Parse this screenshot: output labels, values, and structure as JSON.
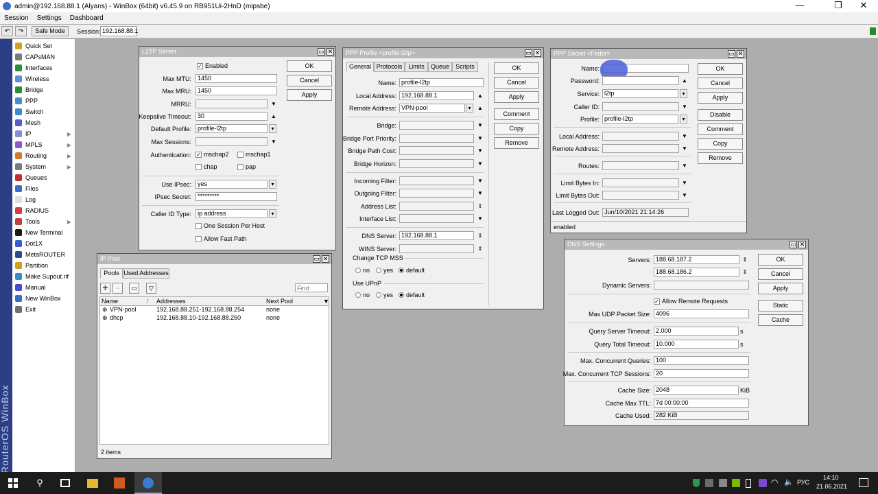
{
  "window": {
    "title": "admin@192.168.88.1 (Alyans) - WinBox (64bit) v6.45.9 on RB951Ui-2HnD (mipsbe)",
    "minimize": "—",
    "maximize": "❐",
    "close": "✕"
  },
  "menu": [
    "Session",
    "Settings",
    "Dashboard"
  ],
  "toolbar": {
    "undo": "↶",
    "redo": "↷",
    "safe_mode": "Safe Mode",
    "session_label": "Session:",
    "session_value": "192.168.88.1"
  },
  "brand": "RouterOS WinBox",
  "sidebar": [
    {
      "label": "Quick Set",
      "color": "#d4a020",
      "arrow": ""
    },
    {
      "label": "CAPsMAN",
      "color": "#7a7a7a",
      "arrow": ""
    },
    {
      "label": "Interfaces",
      "color": "#2e8b3a",
      "arrow": ""
    },
    {
      "label": "Wireless",
      "color": "#5b8fd0",
      "arrow": ""
    },
    {
      "label": "Bridge",
      "color": "#2e8b3a",
      "arrow": ""
    },
    {
      "label": "PPP",
      "color": "#4a8acb",
      "arrow": ""
    },
    {
      "label": "Switch",
      "color": "#3b8ad0",
      "arrow": ""
    },
    {
      "label": "Mesh",
      "color": "#5a5ad0",
      "arrow": ""
    },
    {
      "label": "IP",
      "color": "#8a8ad0",
      "arrow": "▶"
    },
    {
      "label": "MPLS",
      "color": "#8a5ad0",
      "arrow": "▶"
    },
    {
      "label": "Routing",
      "color": "#d07a2a",
      "arrow": "▶"
    },
    {
      "label": "System",
      "color": "#7a7a7a",
      "arrow": "▶"
    },
    {
      "label": "Queues",
      "color": "#c03030",
      "arrow": ""
    },
    {
      "label": "Files",
      "color": "#3a6fc4",
      "arrow": ""
    },
    {
      "label": "Log",
      "color": "#e0e0e0",
      "arrow": ""
    },
    {
      "label": "RADIUS",
      "color": "#d04040",
      "arrow": ""
    },
    {
      "label": "Tools",
      "color": "#c04040",
      "arrow": "▶"
    },
    {
      "label": "New Terminal",
      "color": "#1a1a1a",
      "arrow": ""
    },
    {
      "label": "Dot1X",
      "color": "#3a5ad0",
      "arrow": ""
    },
    {
      "label": "MetaROUTER",
      "color": "#2a4a9a",
      "arrow": ""
    },
    {
      "label": "Partition",
      "color": "#d0a020",
      "arrow": ""
    },
    {
      "label": "Make Supout.rif",
      "color": "#3a8ad0",
      "arrow": ""
    },
    {
      "label": "Manual",
      "color": "#4a4ad0",
      "arrow": ""
    },
    {
      "label": "New WinBox",
      "color": "#3a6fc4",
      "arrow": ""
    },
    {
      "label": "Exit",
      "color": "#707070",
      "arrow": ""
    }
  ],
  "l2tp": {
    "title": "L2TP Server",
    "enabled": "Enabled",
    "max_mtu_label": "Max MTU:",
    "max_mtu": "1450",
    "max_mru_label": "Max MRU:",
    "max_mru": "1450",
    "mrru_label": "MRRU:",
    "keepalive_label": "Keepalive Timeout:",
    "keepalive": "30",
    "default_profile_label": "Default Profile:",
    "default_profile": "profile-l2tp",
    "max_sessions_label": "Max Sessions:",
    "auth_label": "Authentication:",
    "auth_mschap2": "mschap2",
    "auth_mschap1": "mschap1",
    "auth_chap": "chap",
    "auth_pap": "pap",
    "use_ipsec_label": "Use IPsec:",
    "use_ipsec": "yes",
    "ipsec_secret_label": "IPsec Secret:",
    "ipsec_secret": "*********",
    "caller_id_label": "Caller ID Type:",
    "caller_id": "ip address",
    "one_session": "One Session Per Host",
    "allow_fast_path": "Allow Fast Path",
    "ok": "OK",
    "cancel": "Cancel",
    "apply": "Apply"
  },
  "ippool": {
    "title": "IP Pool",
    "tab_pools": "Pools",
    "tab_used": "Used Addresses",
    "add": "+",
    "remove": "−",
    "find_placeholder": "Find",
    "col_name": "Name",
    "col_addresses": "Addresses",
    "col_next": "Next Pool",
    "rows": [
      {
        "name": "VPN-pool",
        "addresses": "192.168.88.251-192.168.88.254",
        "next": "none"
      },
      {
        "name": "dhcp",
        "addresses": "192.168.88.10-192.168.88.250",
        "next": "none"
      }
    ],
    "status": "2 items"
  },
  "profile": {
    "title": "PPP Profile <profile-l2tp>",
    "tabs": [
      "General",
      "Protocols",
      "Limits",
      "Queue",
      "Scripts"
    ],
    "name_label": "Name:",
    "name": "profile-l2tp",
    "local_label": "Local Address:",
    "local": "192.168.88.1",
    "remote_label": "Remote Address:",
    "remote": "VPN-pool",
    "bridge_label": "Bridge:",
    "bpp_label": "Bridge Port Priority:",
    "bpc_label": "Bridge Path Cost:",
    "bh_label": "Bridge Horizon:",
    "in_filter_label": "Incoming Filter:",
    "out_filter_label": "Outgoing Filter:",
    "addr_list_label": "Address List:",
    "iface_list_label": "Interface List:",
    "dns_label": "DNS Server:",
    "dns": "192.168.88.1",
    "wins_label": "WINS Server:",
    "tcp_mss_label": "Change TCP MSS",
    "upnp_label": "Use UPnP",
    "opt_no": "no",
    "opt_yes": "yes",
    "opt_default": "default",
    "ok": "OK",
    "cancel": "Cancel",
    "apply": "Apply",
    "comment": "Comment",
    "copy": "Copy",
    "remove": "Remove"
  },
  "secret": {
    "title": "PPP Secret <Fedor>",
    "name_label": "Name:",
    "password_label": "Password:",
    "service_label": "Service:",
    "service": "l2tp",
    "caller_label": "Caller ID:",
    "profile_label": "Profile:",
    "profile": "profile-l2tp",
    "local_label": "Local Address:",
    "remote_label": "Remote Address:",
    "routes_label": "Routes:",
    "limit_in_label": "Limit Bytes In:",
    "limit_out_label": "Limit Bytes Out:",
    "last_logged_label": "Last Logged Out:",
    "last_logged": "Jun/10/2021 21:14:26",
    "status": "enabled",
    "ok": "OK",
    "cancel": "Cancel",
    "apply": "Apply",
    "disable": "Disable",
    "comment": "Comment",
    "copy": "Copy",
    "remove": "Remove"
  },
  "dns": {
    "title": "DNS Settings",
    "servers_label": "Servers:",
    "server1": "188.68.187.2",
    "server2": "188.68.186.2",
    "dynamic_label": "Dynamic Servers:",
    "allow_remote": "Allow Remote Requests",
    "max_udp_label": "Max UDP Packet Size:",
    "max_udp": "4096",
    "qst_label": "Query Server Timeout:",
    "qst": "2.000",
    "qtt_label": "Query Total Timeout:",
    "qtt": "10.000",
    "unit_s": "s",
    "mcq_label": "Max. Concurrent Queries:",
    "mcq": "100",
    "mctcp_label": "Max. Concurrent TCP Sessions:",
    "mctcp": "20",
    "cache_size_label": "Cache Size:",
    "cache_size": "2048",
    "unit_kib": "KiB",
    "cache_ttl_label": "Cache Max TTL:",
    "cache_ttl": "7d 00:00:00",
    "cache_used_label": "Cache Used:",
    "cache_used": "282 KiB",
    "ok": "OK",
    "cancel": "Cancel",
    "apply": "Apply",
    "static": "Static",
    "cache": "Cache"
  },
  "taskbar": {
    "lang": "РУС",
    "time": "14:10",
    "date": "21.06.2021"
  }
}
